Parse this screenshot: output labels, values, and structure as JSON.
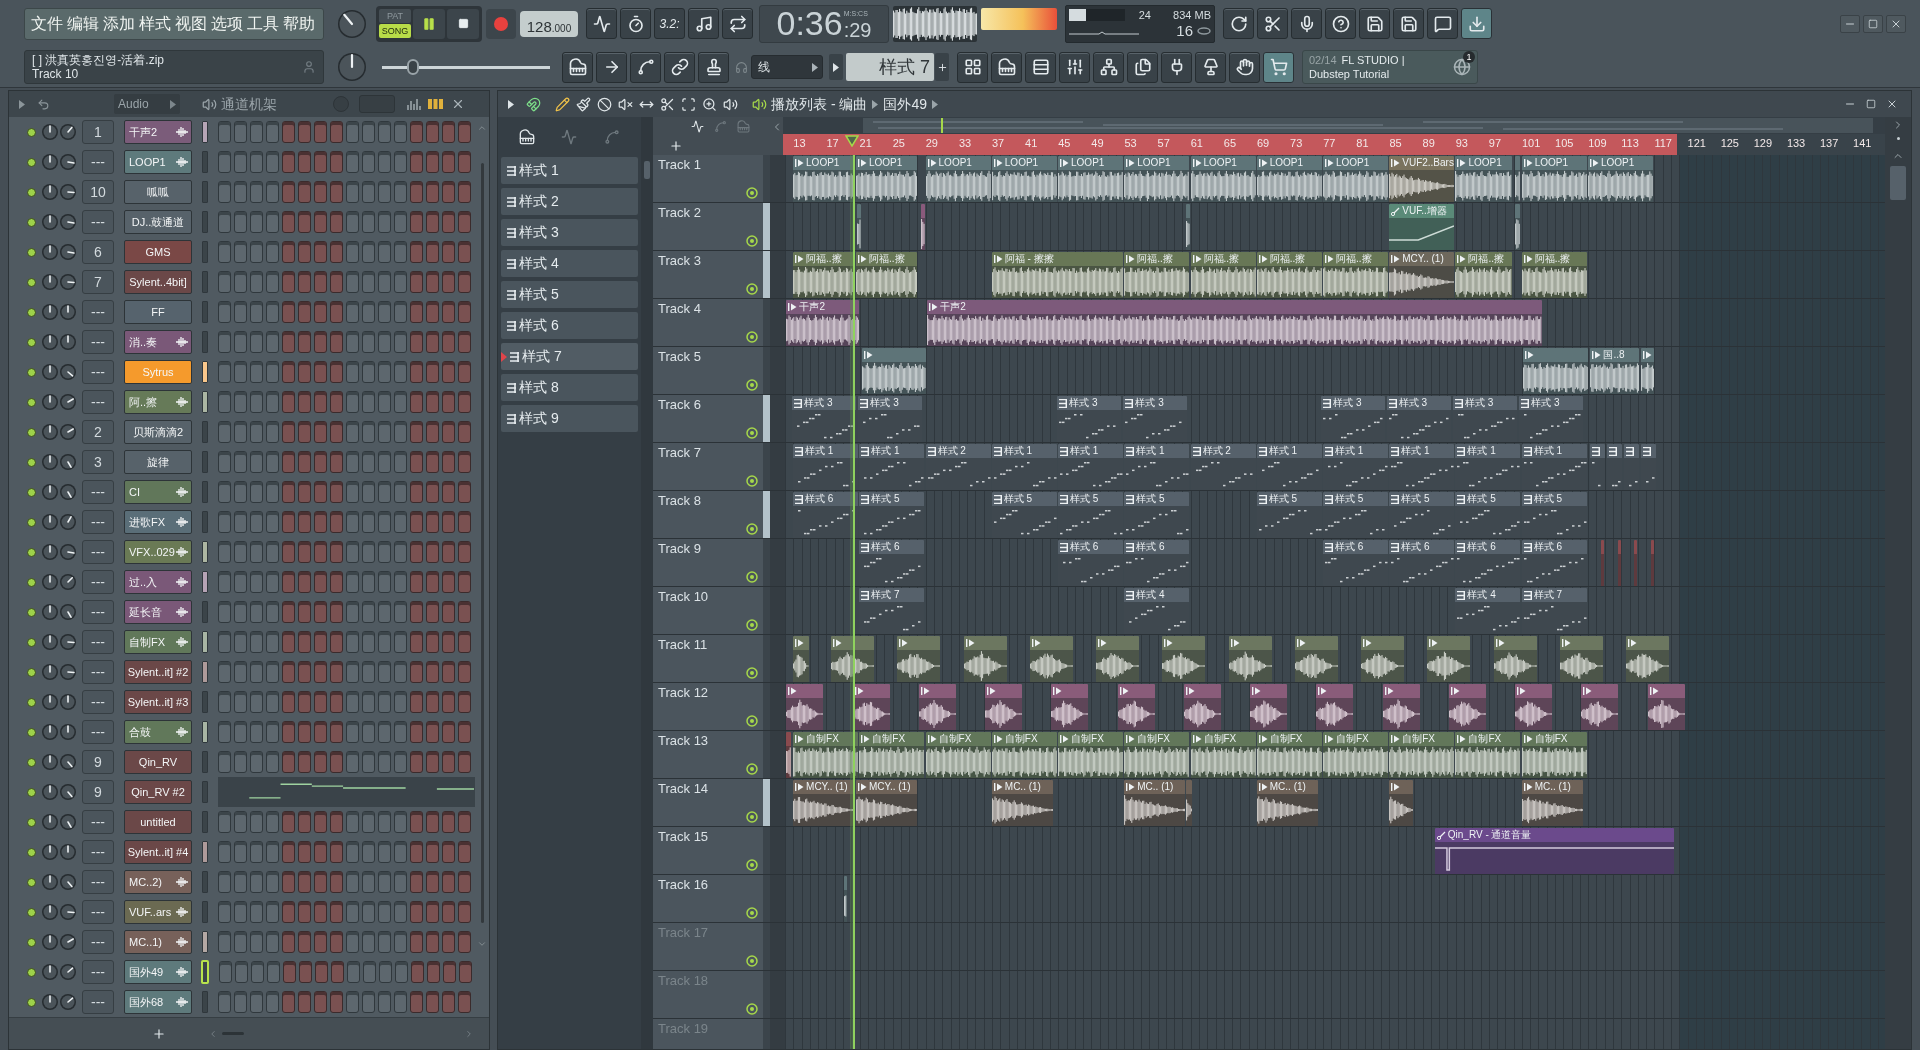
{
  "menu": [
    "文件",
    "编辑",
    "添加",
    "样式",
    "视图",
    "选项",
    "工具",
    "帮助"
  ],
  "hint": {
    "title": "[ ] 洪真英홍진영-活着.zip",
    "subtitle": "Track 10"
  },
  "transport": {
    "modes": [
      {
        "label": "PAT",
        "selected": false
      },
      {
        "label": "SONG",
        "selected": true
      }
    ],
    "playing": true,
    "tempo": "128",
    "tempo_decimals": ".000"
  },
  "countdown": "3.2:",
  "clock": {
    "time": "0:36",
    "centiseconds": ":29",
    "format": "M:S:CS"
  },
  "monitor": {
    "cpu": {
      "level": 0.3,
      "value": "24"
    },
    "memory": "834 MB",
    "polyphony": "16"
  },
  "pitch": {
    "level": 0.16
  },
  "snap": {
    "value": "线"
  },
  "pattern_selector": {
    "value": "样式 7"
  },
  "news": {
    "date": "02/14",
    "title": "FL STUDIO |",
    "subtitle": "Dubstep Tutorial",
    "badge": "1"
  },
  "channel_rack": {
    "filter": "Audio",
    "title": "通道机架",
    "channels": [
      {
        "number": "1",
        "name": "干声2",
        "kind": "audio",
        "color": "#7b5c7a",
        "selected": true,
        "focused": false
      },
      {
        "number": "---",
        "name": "LOOP1",
        "kind": "audio",
        "color": "#5e7a7c",
        "selected": false,
        "focused": false
      },
      {
        "number": "10",
        "name": "呱呱",
        "kind": "plugin",
        "color": "#57626a",
        "selected": false,
        "focused": false
      },
      {
        "number": "---",
        "name": "DJ..鼓通道",
        "kind": "plugin",
        "color": "#57626a",
        "selected": false,
        "focused": false
      },
      {
        "number": "6",
        "name": "GMS",
        "kind": "plugin",
        "color": "#7a4846",
        "selected": false,
        "focused": false
      },
      {
        "number": "7",
        "name": "Sylent..4bit]",
        "kind": "plugin",
        "color": "#6b4848",
        "selected": false,
        "focused": false
      },
      {
        "number": "---",
        "name": "FF",
        "kind": "plugin",
        "color": "#56636d",
        "selected": false,
        "focused": false
      },
      {
        "number": "---",
        "name": "消..奏",
        "kind": "audio",
        "color": "#7a5878",
        "selected": false,
        "focused": false
      },
      {
        "number": "---",
        "name": "Sytrus",
        "kind": "plugin",
        "color": "#f59a2c",
        "selected": true,
        "focused": false
      },
      {
        "number": "---",
        "name": "阿..擦",
        "kind": "audio",
        "color": "#667a58",
        "selected": true,
        "focused": false
      },
      {
        "number": "2",
        "name": "贝斯滴滴2",
        "kind": "plugin",
        "color": "#57626a",
        "selected": false,
        "focused": false
      },
      {
        "number": "3",
        "name": "旋律",
        "kind": "plugin",
        "color": "#57626a",
        "selected": false,
        "focused": false
      },
      {
        "number": "---",
        "name": "CI",
        "kind": "audio",
        "color": "#61775a",
        "selected": false,
        "focused": false
      },
      {
        "number": "---",
        "name": "进歌FX",
        "kind": "audio",
        "color": "#5a6e78",
        "selected": false,
        "focused": false
      },
      {
        "number": "---",
        "name": "VFX..029",
        "kind": "audio",
        "color": "#6a7a55",
        "selected": true,
        "focused": false
      },
      {
        "number": "---",
        "name": "过..入",
        "kind": "audio",
        "color": "#7a5878",
        "selected": true,
        "focused": false
      },
      {
        "number": "---",
        "name": "延长音",
        "kind": "audio",
        "color": "#7a5878",
        "selected": false,
        "focused": false
      },
      {
        "number": "---",
        "name": "自制FX",
        "kind": "audio",
        "color": "#61785a",
        "selected": true,
        "focused": false
      },
      {
        "number": "---",
        "name": "Sylent..it] #2",
        "kind": "plugin",
        "color": "#6b4848",
        "selected": true,
        "focused": false
      },
      {
        "number": "---",
        "name": "Sylent..it] #3",
        "kind": "plugin",
        "color": "#6b4848",
        "selected": false,
        "focused": false
      },
      {
        "number": "---",
        "name": "合鼓",
        "kind": "audio",
        "color": "#61785a",
        "selected": true,
        "focused": false
      },
      {
        "number": "9",
        "name": "Qin_RV",
        "kind": "plugin",
        "color": "#6b4848",
        "selected": false,
        "focused": false
      },
      {
        "number": "9",
        "name": "Qin_RV #2",
        "kind": "automation",
        "color": "#6b4848",
        "selected": false,
        "focused": false
      },
      {
        "number": "---",
        "name": "untitled",
        "kind": "plugin",
        "color": "#6b4848",
        "selected": false,
        "focused": false
      },
      {
        "number": "---",
        "name": "Sylent..it] #4",
        "kind": "plugin",
        "color": "#6b4848",
        "selected": true,
        "focused": false
      },
      {
        "number": "---",
        "name": "MC..2)",
        "kind": "audio",
        "color": "#77615a",
        "selected": false,
        "focused": false
      },
      {
        "number": "---",
        "name": "VUF..ars",
        "kind": "audio",
        "color": "#6b6a52",
        "selected": false,
        "focused": false
      },
      {
        "number": "---",
        "name": "MC..1)",
        "kind": "audio",
        "color": "#77615a",
        "selected": true,
        "focused": false
      },
      {
        "number": "---",
        "name": "国外49",
        "kind": "audio",
        "color": "#5e7a7c",
        "selected": false,
        "focused": true
      },
      {
        "number": "---",
        "name": "国外68",
        "kind": "audio",
        "color": "#5e7a7c",
        "selected": false,
        "focused": false
      }
    ]
  },
  "playlist": {
    "title": "播放列表 - 编曲",
    "crumb": "国外49",
    "patterns": [
      {
        "label": "样式 1",
        "selected": false
      },
      {
        "label": "样式 2",
        "selected": false
      },
      {
        "label": "样式 3",
        "selected": false
      },
      {
        "label": "样式 4",
        "selected": false
      },
      {
        "label": "样式 5",
        "selected": false
      },
      {
        "label": "样式 6",
        "selected": false
      },
      {
        "label": "样式 7",
        "selected": true
      },
      {
        "label": "样式 8",
        "selected": false
      },
      {
        "label": "样式 9",
        "selected": false
      }
    ],
    "ruler": [
      "13",
      "17",
      "21",
      "25",
      "29",
      "33",
      "37",
      "41",
      "45",
      "49",
      "53",
      "57",
      "61",
      "65",
      "69",
      "73",
      "77",
      "81",
      "85",
      "89",
      "93",
      "97",
      "101",
      "105",
      "109",
      "113",
      "117",
      "121",
      "125",
      "129",
      "133",
      "137",
      "141"
    ],
    "tracks": [
      {
        "name": "Track 1",
        "selected": false,
        "dimmed": false,
        "clips": [
          {
            "label": "LOOP1",
            "kind": "audio",
            "color": "#5e7478"
          },
          {
            "label": "LOOP1",
            "kind": "audio",
            "color": "#5e7478"
          },
          {
            "label": "LOOP1",
            "kind": "audio",
            "color": "#5e7478"
          },
          {
            "label": "LOOP1",
            "kind": "audio",
            "color": "#5e7478"
          },
          {
            "label": "LOOP1",
            "kind": "audio",
            "color": "#5e7478"
          },
          {
            "label": "LOOP1",
            "kind": "audio",
            "color": "#5e7478"
          },
          {
            "label": "LOOP1",
            "kind": "audio",
            "color": "#5e7478"
          },
          {
            "label": "LOOP1",
            "kind": "audio",
            "color": "#5e7478"
          },
          {
            "label": "LOOP1",
            "kind": "audio",
            "color": "#5e7478"
          },
          {
            "label": "VUF2..Bars",
            "kind": "audio",
            "color": "#7a735e"
          },
          {
            "label": "LOOP1",
            "kind": "audio",
            "color": "#5e7478"
          },
          {
            "kind": "audio",
            "color": "#5e7478"
          },
          {
            "label": "LOOP1",
            "kind": "audio",
            "color": "#5e7478"
          },
          {
            "label": "LOOP1",
            "kind": "audio",
            "color": "#5e7478"
          }
        ]
      },
      {
        "name": "Track 2",
        "selected": true,
        "dimmed": false,
        "clips": [
          {
            "kind": "audio",
            "color": "#5e7478"
          },
          {
            "kind": "audio",
            "color": "#8a5a7c"
          },
          {
            "kind": "audio",
            "color": "#5e7478"
          },
          {
            "label": "VUF..增器",
            "kind": "automation",
            "color": "#5a8a78"
          },
          {
            "kind": "audio",
            "color": "#5e7478"
          }
        ]
      },
      {
        "name": "Track 3",
        "selected": true,
        "dimmed": false,
        "clips": [
          {
            "label": "阿福..擦",
            "kind": "audio",
            "color": "#687756"
          },
          {
            "label": "阿福..擦",
            "kind": "audio",
            "color": "#687756"
          },
          {
            "label": "阿福 - 擦擦",
            "kind": "audio",
            "color": "#687756"
          },
          {
            "label": "阿福..擦",
            "kind": "audio",
            "color": "#687756"
          },
          {
            "label": "阿福..擦",
            "kind": "audio",
            "color": "#687756"
          },
          {
            "label": "阿福..擦",
            "kind": "audio",
            "color": "#687756"
          },
          {
            "label": "阿福..擦",
            "kind": "audio",
            "color": "#687756"
          },
          {
            "label": "MCY.. (1)",
            "kind": "audio",
            "color": "#6e685c"
          },
          {
            "label": "阿福..擦",
            "kind": "audio",
            "color": "#687756"
          },
          {
            "label": "阿福..擦",
            "kind": "audio",
            "color": "#687756"
          }
        ]
      },
      {
        "name": "Track 4",
        "selected": false,
        "dimmed": false,
        "clips": [
          {
            "label": "干声2",
            "kind": "audio",
            "color": "#7d5a7b"
          },
          {
            "label": "干声2",
            "kind": "audio",
            "color": "#7d5a7b"
          }
        ]
      },
      {
        "name": "Track 5",
        "selected": false,
        "dimmed": false,
        "clips": [
          {
            "kind": "audio",
            "color": "#5e7478"
          },
          {
            "kind": "audio",
            "color": "#5e7478"
          },
          {
            "label": "国..8",
            "kind": "audio",
            "color": "#5e7478"
          },
          {
            "kind": "audio",
            "color": "#5e7478"
          }
        ]
      },
      {
        "name": "Track 6",
        "selected": true,
        "dimmed": false,
        "clips": [
          {
            "label": "样式 3",
            "kind": "pattern",
            "color": "#56616b"
          },
          {
            "label": "样式 3",
            "kind": "pattern",
            "color": "#56616b"
          },
          {
            "label": "样式 3",
            "kind": "pattern",
            "color": "#56616b"
          },
          {
            "label": "样式 3",
            "kind": "pattern",
            "color": "#56616b"
          },
          {
            "label": "样式 3",
            "kind": "pattern",
            "color": "#56616b"
          },
          {
            "label": "样式 3",
            "kind": "pattern",
            "color": "#56616b"
          },
          {
            "label": "样式 3",
            "kind": "pattern",
            "color": "#56616b"
          },
          {
            "label": "样式 3",
            "kind": "pattern",
            "color": "#56616b"
          }
        ]
      },
      {
        "name": "Track 7",
        "selected": false,
        "dimmed": false,
        "clips": [
          {
            "label": "样式 1",
            "kind": "pattern",
            "color": "#56616b"
          },
          {
            "label": "样式 1",
            "kind": "pattern",
            "color": "#56616b"
          },
          {
            "label": "样式 2",
            "kind": "pattern",
            "color": "#56616b"
          },
          {
            "label": "样式 1",
            "kind": "pattern",
            "color": "#56616b"
          },
          {
            "label": "样式 1",
            "kind": "pattern",
            "color": "#56616b"
          },
          {
            "label": "样式 1",
            "kind": "pattern",
            "color": "#56616b"
          },
          {
            "label": "样式 2",
            "kind": "pattern",
            "color": "#56616b"
          },
          {
            "label": "样式 1",
            "kind": "pattern",
            "color": "#56616b"
          },
          {
            "label": "样式 1",
            "kind": "pattern",
            "color": "#56616b"
          },
          {
            "label": "样式 1",
            "kind": "pattern",
            "color": "#56616b"
          },
          {
            "label": "样式 1",
            "kind": "pattern",
            "color": "#56616b"
          },
          {
            "label": "样式 1",
            "kind": "pattern",
            "color": "#56616b"
          },
          {
            "kind": "pattern",
            "color": "#56616b"
          },
          {
            "kind": "pattern",
            "color": "#56616b"
          },
          {
            "kind": "pattern",
            "color": "#56616b"
          },
          {
            "kind": "pattern",
            "color": "#56616b"
          }
        ]
      },
      {
        "name": "Track 8",
        "selected": true,
        "dimmed": false,
        "clips": [
          {
            "label": "样式 6",
            "kind": "pattern",
            "color": "#56616b"
          },
          {
            "label": "样式 5",
            "kind": "pattern",
            "color": "#56616b"
          },
          {
            "label": "样式 5",
            "kind": "pattern",
            "color": "#56616b"
          },
          {
            "label": "样式 5",
            "kind": "pattern",
            "color": "#56616b"
          },
          {
            "label": "样式 5",
            "kind": "pattern",
            "color": "#56616b"
          },
          {
            "label": "样式 5",
            "kind": "pattern",
            "color": "#56616b"
          },
          {
            "label": "样式 5",
            "kind": "pattern",
            "color": "#56616b"
          },
          {
            "label": "样式 5",
            "kind": "pattern",
            "color": "#56616b"
          },
          {
            "label": "样式 5",
            "kind": "pattern",
            "color": "#56616b"
          },
          {
            "label": "样式 5",
            "kind": "pattern",
            "color": "#56616b"
          }
        ]
      },
      {
        "name": "Track 9",
        "selected": false,
        "dimmed": false,
        "clips": [
          {
            "label": "样式 6",
            "kind": "pattern",
            "color": "#56616b"
          },
          {
            "label": "样式 6",
            "kind": "pattern",
            "color": "#56616b"
          },
          {
            "label": "样式 6",
            "kind": "pattern",
            "color": "#56616b"
          },
          {
            "label": "样式 6",
            "kind": "pattern",
            "color": "#56616b"
          },
          {
            "label": "样式 6",
            "kind": "pattern",
            "color": "#56616b"
          },
          {
            "label": "样式 6",
            "kind": "pattern",
            "color": "#56616b"
          },
          {
            "label": "样式 6",
            "kind": "pattern",
            "color": "#56616b"
          },
          {
            "kind": "pattern",
            "color": "#8a4a4e"
          },
          {
            "kind": "pattern",
            "color": "#8a4a4e"
          },
          {
            "kind": "pattern",
            "color": "#8a4a4e"
          },
          {
            "kind": "pattern",
            "color": "#8a4a4e"
          }
        ]
      },
      {
        "name": "Track 10",
        "selected": false,
        "dimmed": false,
        "clips": [
          {
            "label": "样式 7",
            "kind": "pattern",
            "color": "#56616b"
          },
          {
            "label": "样式 4",
            "kind": "pattern",
            "color": "#56616b"
          },
          {
            "label": "样式 4",
            "kind": "pattern",
            "color": "#56616b"
          },
          {
            "label": "样式 7",
            "kind": "pattern",
            "color": "#56616b"
          }
        ]
      },
      {
        "name": "Track 11",
        "selected": false,
        "dimmed": false,
        "clips": [
          {
            "kind": "audio",
            "color": "#6c7760"
          },
          {
            "kind": "audio",
            "color": "#6c7760"
          },
          {
            "kind": "audio",
            "color": "#6c7760"
          },
          {
            "kind": "audio",
            "color": "#6c7760"
          },
          {
            "kind": "audio",
            "color": "#6c7760"
          },
          {
            "kind": "audio",
            "color": "#6c7760"
          },
          {
            "kind": "audio",
            "color": "#6c7760"
          },
          {
            "kind": "audio",
            "color": "#6c7760"
          },
          {
            "kind": "audio",
            "color": "#6c7760"
          },
          {
            "kind": "audio",
            "color": "#6c7760"
          },
          {
            "kind": "audio",
            "color": "#6c7760"
          },
          {
            "kind": "audio",
            "color": "#6c7760"
          },
          {
            "kind": "audio",
            "color": "#6c7760"
          },
          {
            "kind": "audio",
            "color": "#6c7760"
          }
        ]
      },
      {
        "name": "Track 12",
        "selected": false,
        "dimmed": false,
        "clips": [
          {
            "kind": "audio",
            "color": "#8a5c7a"
          },
          {
            "kind": "audio",
            "color": "#8a5c7a"
          },
          {
            "kind": "audio",
            "color": "#8a5c7a"
          },
          {
            "kind": "audio",
            "color": "#8a5c7a"
          },
          {
            "kind": "audio",
            "color": "#8a5c7a"
          },
          {
            "kind": "audio",
            "color": "#8a5c7a"
          },
          {
            "kind": "audio",
            "color": "#8a5c7a"
          },
          {
            "kind": "audio",
            "color": "#8a5c7a"
          },
          {
            "kind": "audio",
            "color": "#8a5c7a"
          },
          {
            "kind": "audio",
            "color": "#8a5c7a"
          },
          {
            "kind": "audio",
            "color": "#8a5c7a"
          },
          {
            "kind": "audio",
            "color": "#8a5c7a"
          },
          {
            "kind": "audio",
            "color": "#8a5c7a"
          },
          {
            "kind": "audio",
            "color": "#8a5c7a"
          }
        ]
      },
      {
        "name": "Track 13",
        "selected": false,
        "dimmed": false,
        "clips": [
          {
            "kind": "audio",
            "color": "#8a4a4e"
          },
          {
            "label": "自制FX",
            "kind": "audio",
            "color": "#62775a"
          },
          {
            "label": "自制FX",
            "kind": "audio",
            "color": "#62775a"
          },
          {
            "label": "自制FX",
            "kind": "audio",
            "color": "#62775a"
          },
          {
            "label": "自制FX",
            "kind": "audio",
            "color": "#62775a"
          },
          {
            "label": "自制FX",
            "kind": "audio",
            "color": "#62775a"
          },
          {
            "label": "自制FX",
            "kind": "audio",
            "color": "#62775a"
          },
          {
            "label": "自制FX",
            "kind": "audio",
            "color": "#62775a"
          },
          {
            "label": "自制FX",
            "kind": "audio",
            "color": "#62775a"
          },
          {
            "label": "自制FX",
            "kind": "audio",
            "color": "#62775a"
          },
          {
            "label": "自制FX",
            "kind": "audio",
            "color": "#62775a"
          },
          {
            "label": "自制FX",
            "kind": "audio",
            "color": "#62775a"
          },
          {
            "label": "自制FX",
            "kind": "audio",
            "color": "#62775a"
          }
        ]
      },
      {
        "name": "Track 14",
        "selected": true,
        "dimmed": false,
        "clips": [
          {
            "label": "MCY.. (1)",
            "kind": "audio",
            "color": "#6e6258"
          },
          {
            "label": "MCY.. (1)",
            "kind": "audio",
            "color": "#6e6258"
          },
          {
            "label": "MC.. (1)",
            "kind": "audio",
            "color": "#6e6258"
          },
          {
            "label": "MC.. (1)",
            "kind": "audio",
            "color": "#6e6258"
          },
          {
            "kind": "audio",
            "color": "#6e6258"
          },
          {
            "label": "MC.. (1)",
            "kind": "audio",
            "color": "#6e6258"
          },
          {
            "kind": "audio",
            "color": "#6e6258"
          },
          {
            "label": "MC.. (1)",
            "kind": "audio",
            "color": "#6e6258"
          }
        ]
      },
      {
        "name": "Track 15",
        "selected": false,
        "dimmed": false,
        "clips": [
          {
            "label": "Qin_RV - 通道音量",
            "kind": "automation",
            "color": "#6b4a8c"
          }
        ]
      },
      {
        "name": "Track 16",
        "selected": false,
        "dimmed": false,
        "clips": [
          {
            "kind": "audio",
            "color": "#5e7478"
          }
        ]
      },
      {
        "name": "Track 17",
        "selected": false,
        "dimmed": true
      },
      {
        "name": "Track 18",
        "selected": false,
        "dimmed": true
      },
      {
        "name": "Track 19",
        "selected": false,
        "dimmed": true
      }
    ]
  }
}
